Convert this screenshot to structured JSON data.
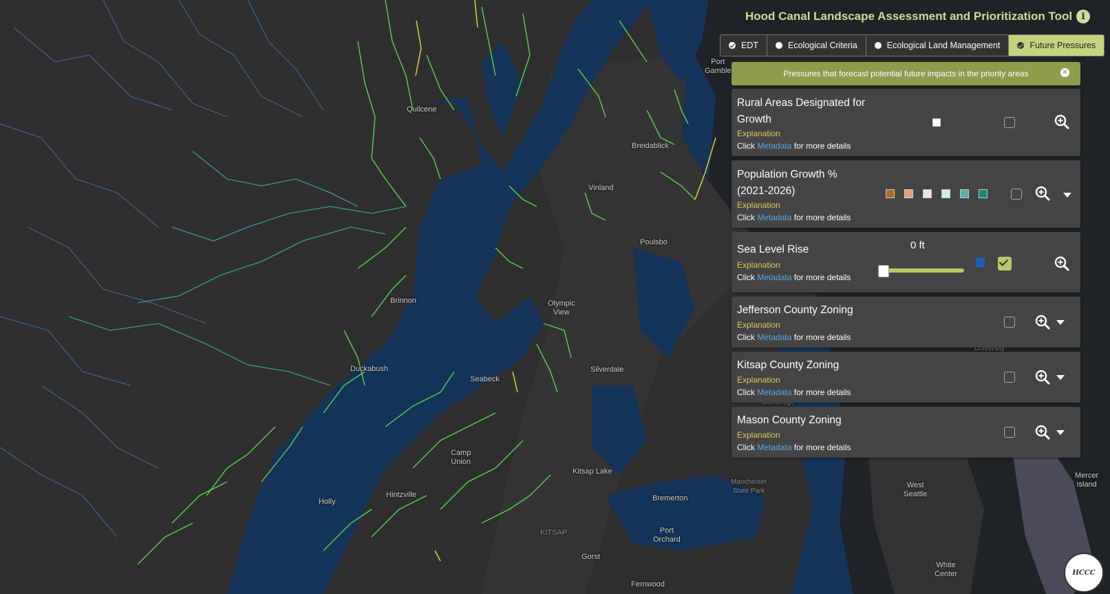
{
  "app": {
    "title": "Hood Canal Landscape Assessment and Prioritization Tool",
    "info_icon": "info-icon"
  },
  "tabs": [
    {
      "label": "EDT",
      "checked": true
    },
    {
      "label": "Ecological Criteria",
      "checked": false
    },
    {
      "label": "Ecological Land Management",
      "checked": false
    },
    {
      "label": "Future Pressures",
      "checked": true,
      "active": true
    }
  ],
  "banner": {
    "text": "Pressures that forecast potential future impacts in the priority areas",
    "close": "×"
  },
  "common": {
    "explanation": "Explanation",
    "click": "Click",
    "metadata": "Metadata",
    "more": "for more details"
  },
  "layers": [
    {
      "name": "Rural Areas Designated for Growth",
      "checked": false
    },
    {
      "name": "Population Growth % (2021-2026)",
      "checked": false
    },
    {
      "name": "Sea Level Rise",
      "checked": true,
      "slider_value": "0 ft",
      "slider_fraction": 0.0
    },
    {
      "name": "Jefferson County Zoning",
      "checked": false
    },
    {
      "name": "Kitsap County Zoning",
      "checked": false
    },
    {
      "name": "Mason County Zoning",
      "checked": false
    }
  ],
  "colors": {
    "accent": "#c4d37e",
    "banner": "#8e9c4d",
    "water": "#14345a",
    "sea_level_swatch": "#1e5fb0",
    "population_swatches": [
      "#b5661c",
      "#d7a47e",
      "#efe3d8",
      "#c9eef0",
      "#4fb5a7",
      "#148a7b"
    ]
  },
  "places": [
    {
      "name": "Quilcene"
    },
    {
      "name": "Breidablick"
    },
    {
      "name": "Port\nGamble"
    },
    {
      "name": "Vinland"
    },
    {
      "name": "Poulsbo"
    },
    {
      "name": "Brinnon"
    },
    {
      "name": "Olympic\nView"
    },
    {
      "name": "Duckabush"
    },
    {
      "name": "Seabeck"
    },
    {
      "name": "Silverdale"
    },
    {
      "name": "Camp\nUnion"
    },
    {
      "name": "Kitsap Lake"
    },
    {
      "name": "Holly"
    },
    {
      "name": "Hintzville"
    },
    {
      "name": "Bremerton"
    },
    {
      "name": "KITSAP"
    },
    {
      "name": "Port\nOrchard"
    },
    {
      "name": "Gorst"
    },
    {
      "name": "Fernwood"
    },
    {
      "name": "Manchester\nState Park"
    },
    {
      "name": "West\nSeattle"
    },
    {
      "name": "Mercer\nIsland"
    },
    {
      "name": "White\nCenter"
    },
    {
      "name": "University"
    },
    {
      "name": "Bainbridge"
    }
  ],
  "logo": {
    "text": "HCCC"
  }
}
